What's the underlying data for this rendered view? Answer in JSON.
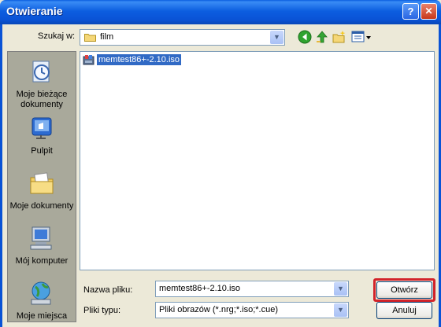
{
  "window": {
    "title": "Otwieranie",
    "help_button": "?",
    "close_button": "✕"
  },
  "lookin": {
    "label": "Szukaj w:",
    "value": "film"
  },
  "places": [
    {
      "label": "Moje bieżące dokumenty",
      "icon": "recent-documents-icon"
    },
    {
      "label": "Pulpit",
      "icon": "desktop-icon"
    },
    {
      "label": "Moje dokumenty",
      "icon": "my-documents-icon"
    },
    {
      "label": "Mój komputer",
      "icon": "my-computer-icon"
    },
    {
      "label": "Moje miejsca",
      "icon": "network-places-icon"
    }
  ],
  "files": [
    {
      "name": "memtest86+-2.10.iso",
      "selected": true
    }
  ],
  "filename": {
    "label": "Nazwa pliku:",
    "value": "memtest86+-2.10.iso"
  },
  "filetype": {
    "label": "Pliki typu:",
    "value": "Pliki obrazów (*.nrg;*.iso;*.cue)"
  },
  "buttons": {
    "open": "Otwórz",
    "cancel": "Anuluj"
  },
  "colors": {
    "titlebar": "#0a53d6",
    "selection": "#316ac5",
    "highlight": "#d2232a"
  }
}
